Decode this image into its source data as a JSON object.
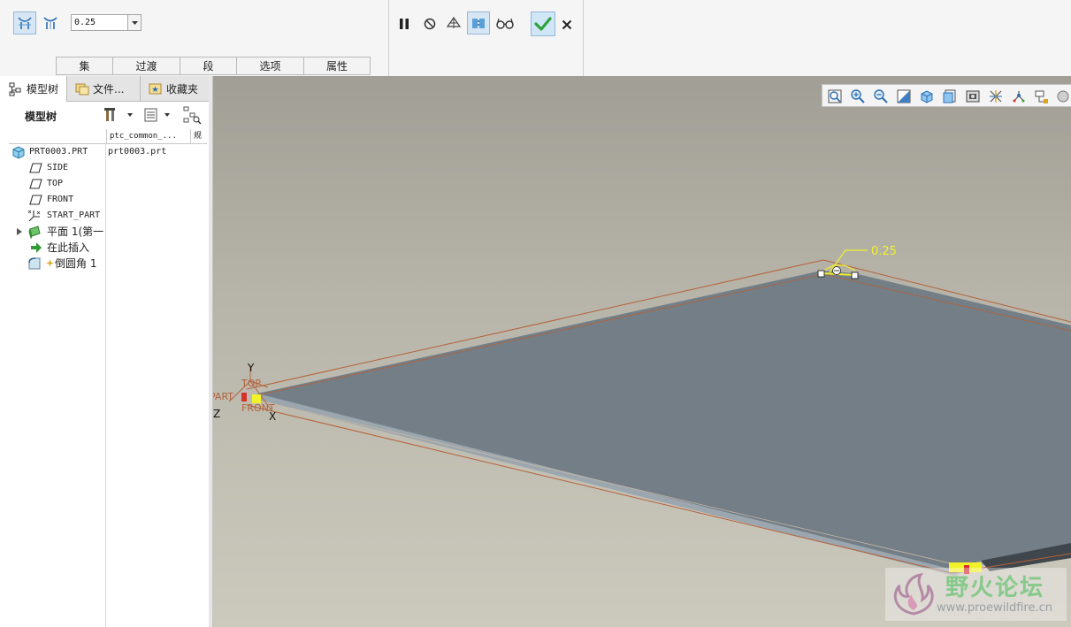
{
  "dashboard": {
    "radius_value": "0.25",
    "tabs": [
      {
        "label": "集"
      },
      {
        "label": "过渡"
      },
      {
        "label": "段"
      },
      {
        "label": "选项"
      },
      {
        "label": "属性"
      }
    ],
    "left_buttons": [
      {
        "name": "round-set-mode-icon",
        "active": true
      },
      {
        "name": "transition-mode-icon",
        "active": false
      }
    ],
    "mid_buttons": [
      {
        "name": "pause-icon"
      },
      {
        "name": "no-preview-icon"
      },
      {
        "name": "geometry-preview-icon"
      },
      {
        "name": "attached-preview-icon",
        "active": true
      },
      {
        "name": "verify-glasses-icon"
      },
      {
        "name": "ok-checkmark-icon"
      },
      {
        "name": "cancel-x-icon"
      }
    ]
  },
  "navigator": {
    "tabs": [
      {
        "label": "模型树",
        "icon": "model-tree-icon"
      },
      {
        "label": "文件...",
        "icon": "folder-browser-icon"
      },
      {
        "label": "收藏夹",
        "icon": "favorites-icon"
      }
    ],
    "tree_title": "模型树",
    "columns": [
      "ptc_common_...",
      "规"
    ],
    "tree": [
      {
        "label": "PRT0003.PRT",
        "col": "prt0003.prt",
        "icon": "part-icon",
        "indent": 0
      },
      {
        "label": "SIDE",
        "icon": "datum-plane-icon",
        "indent": 1
      },
      {
        "label": "TOP",
        "icon": "datum-plane-icon",
        "indent": 1
      },
      {
        "label": "FRONT",
        "icon": "datum-plane-icon",
        "indent": 1
      },
      {
        "label": "START_PART",
        "icon": "coordinate-system-icon",
        "indent": 1
      },
      {
        "label": "平面 1(第一",
        "icon": "extrude-feature-icon",
        "indent": 1,
        "expandable": true
      },
      {
        "label": "在此插入",
        "icon": "insert-here-arrow-icon",
        "indent": 1
      },
      {
        "label": "倒圆角 1",
        "icon": "round-feature-icon",
        "indent": 1
      }
    ]
  },
  "graphics": {
    "dimension_value": "0.25",
    "datum_labels": {
      "y": "Y",
      "z": "Z",
      "x": "X",
      "top": "TOP",
      "part": "PART",
      "front": "FRONT"
    },
    "view_tools": [
      "refit-icon",
      "zoom-in-icon",
      "zoom-out-icon",
      "repaint-icon",
      "display-style-icon",
      "saved-views-icon",
      "view-manager-icon",
      "datum-display-icon",
      "spin-center-icon",
      "annotation-display-icon",
      "more-tools-icon"
    ],
    "watermark": {
      "title": "野火论坛",
      "url": "www.proewildfire.cn"
    }
  },
  "colors": {
    "plate_top": "#737e86",
    "plate_edge": "#9ba6ae",
    "datum_orange": "#b4623a",
    "highlight_yellow": "#f2f22a",
    "ok_green": "#2fa33a",
    "background_top": "#a19f95",
    "background_bottom": "#ccc9bd"
  }
}
